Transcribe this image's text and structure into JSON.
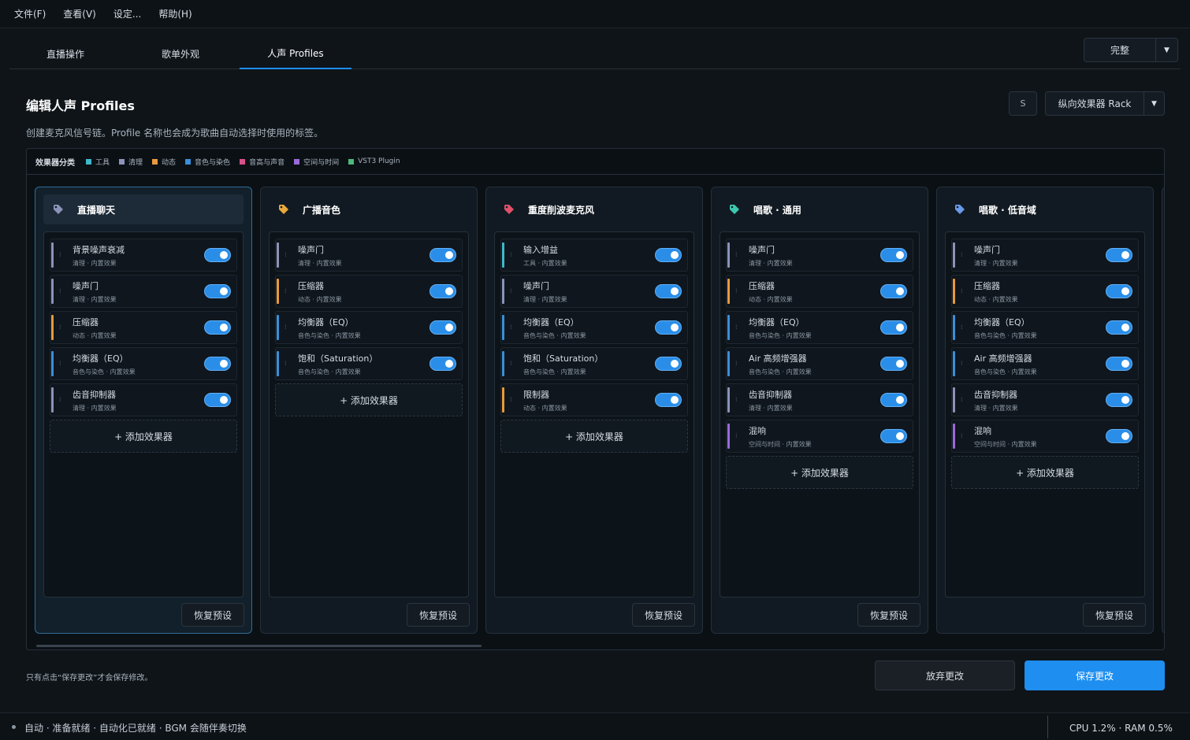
{
  "menu": [
    "文件(F)",
    "查看(V)",
    "设定...",
    "帮助(H)"
  ],
  "tabs": [
    "直播操作",
    "歌单外观",
    "人声 Profiles"
  ],
  "top_button": {
    "label": "完整"
  },
  "header": {
    "title": "编辑人声 Profiles",
    "subtitle": "创建麦克风信号链。Profile 名称也会成为歌曲自动选择时使用的标签。",
    "s_label": "S",
    "rack_label": "纵向效果器 Rack"
  },
  "legend": {
    "title": "效果器分类",
    "items": [
      {
        "label": "工具",
        "color": "#3fb8c8"
      },
      {
        "label": "清理",
        "color": "#8c93b8"
      },
      {
        "label": "动态",
        "color": "#e89a3c"
      },
      {
        "label": "音色与染色",
        "color": "#3a8fd8"
      },
      {
        "label": "音高与声音",
        "color": "#d8508a"
      },
      {
        "label": "空间与时间",
        "color": "#9a6ad8"
      },
      {
        "label": "VST3 Plugin",
        "color": "#4cb87a"
      }
    ]
  },
  "cards": [
    {
      "name": "直播聊天",
      "tag_color": "#8c93b8",
      "effects": [
        {
          "name": "背景噪声衰减",
          "meta": "清理 · 内置效果",
          "color": "#8c93b8"
        },
        {
          "name": "噪声门",
          "meta": "清理 · 内置效果",
          "color": "#8c93b8"
        },
        {
          "name": "压缩器",
          "meta": "动态 · 内置效果",
          "color": "#e89a3c"
        },
        {
          "name": "均衡器（EQ）",
          "meta": "音色与染色 · 内置效果",
          "color": "#3a8fd8"
        },
        {
          "name": "齿音抑制器",
          "meta": "清理 · 内置效果",
          "color": "#8c93b8"
        }
      ],
      "add_label": "+ 添加效果器",
      "reset_label": "恢复预设"
    },
    {
      "name": "广播音色",
      "tag_color": "#e8a83c",
      "effects": [
        {
          "name": "噪声门",
          "meta": "清理 · 内置效果",
          "color": "#8c93b8"
        },
        {
          "name": "压缩器",
          "meta": "动态 · 内置效果",
          "color": "#e89a3c"
        },
        {
          "name": "均衡器（EQ）",
          "meta": "音色与染色 · 内置效果",
          "color": "#3a8fd8"
        },
        {
          "name": "饱和（Saturation）",
          "meta": "音色与染色 · 内置效果",
          "color": "#3a8fd8"
        }
      ],
      "add_label": "+ 添加效果器",
      "reset_label": "恢复预设"
    },
    {
      "name": "重度削波麦克风",
      "tag_color": "#e0506a",
      "effects": [
        {
          "name": "输入增益",
          "meta": "工具 · 内置效果",
          "color": "#3fb8c8"
        },
        {
          "name": "噪声门",
          "meta": "清理 · 内置效果",
          "color": "#8c93b8"
        },
        {
          "name": "均衡器（EQ）",
          "meta": "音色与染色 · 内置效果",
          "color": "#3a8fd8"
        },
        {
          "name": "饱和（Saturation）",
          "meta": "音色与染色 · 内置效果",
          "color": "#3a8fd8"
        },
        {
          "name": "限制器",
          "meta": "动态 · 内置效果",
          "color": "#e89a3c"
        }
      ],
      "add_label": "+ 添加效果器",
      "reset_label": "恢复预设"
    },
    {
      "name": "唱歌 · 通用",
      "tag_color": "#3fc8b0",
      "effects": [
        {
          "name": "噪声门",
          "meta": "清理 · 内置效果",
          "color": "#8c93b8"
        },
        {
          "name": "压缩器",
          "meta": "动态 · 内置效果",
          "color": "#e89a3c"
        },
        {
          "name": "均衡器（EQ）",
          "meta": "音色与染色 · 内置效果",
          "color": "#3a8fd8"
        },
        {
          "name": "Air 高频增强器",
          "meta": "音色与染色 · 内置效果",
          "color": "#3a8fd8"
        },
        {
          "name": "齿音抑制器",
          "meta": "清理 · 内置效果",
          "color": "#8c93b8"
        },
        {
          "name": "混响",
          "meta": "空间与时间 · 内置效果",
          "color": "#9a6ad8"
        }
      ],
      "add_label": "+ 添加效果器",
      "reset_label": "恢复预设"
    },
    {
      "name": "唱歌 · 低音域",
      "tag_color": "#6a9ae8",
      "effects": [
        {
          "name": "噪声门",
          "meta": "清理 · 内置效果",
          "color": "#8c93b8"
        },
        {
          "name": "压缩器",
          "meta": "动态 · 内置效果",
          "color": "#e89a3c"
        },
        {
          "name": "均衡器（EQ）",
          "meta": "音色与染色 · 内置效果",
          "color": "#3a8fd8"
        },
        {
          "name": "Air 高频增强器",
          "meta": "音色与染色 · 内置效果",
          "color": "#3a8fd8"
        },
        {
          "name": "齿音抑制器",
          "meta": "清理 · 内置效果",
          "color": "#8c93b8"
        },
        {
          "name": "混响",
          "meta": "空间与时间 · 内置效果",
          "color": "#9a6ad8"
        }
      ],
      "add_label": "+ 添加效果器",
      "reset_label": "恢复预设"
    }
  ],
  "footer": {
    "note": "只有点击“保存更改”才会保存修改。",
    "discard": "放弃更改",
    "save": "保存更改"
  },
  "status": {
    "left": "自动 · 准备就绪 · 自动化已就绪 · BGM 会随伴奏切换",
    "right": "CPU 1.2% · RAM 0.5%"
  }
}
